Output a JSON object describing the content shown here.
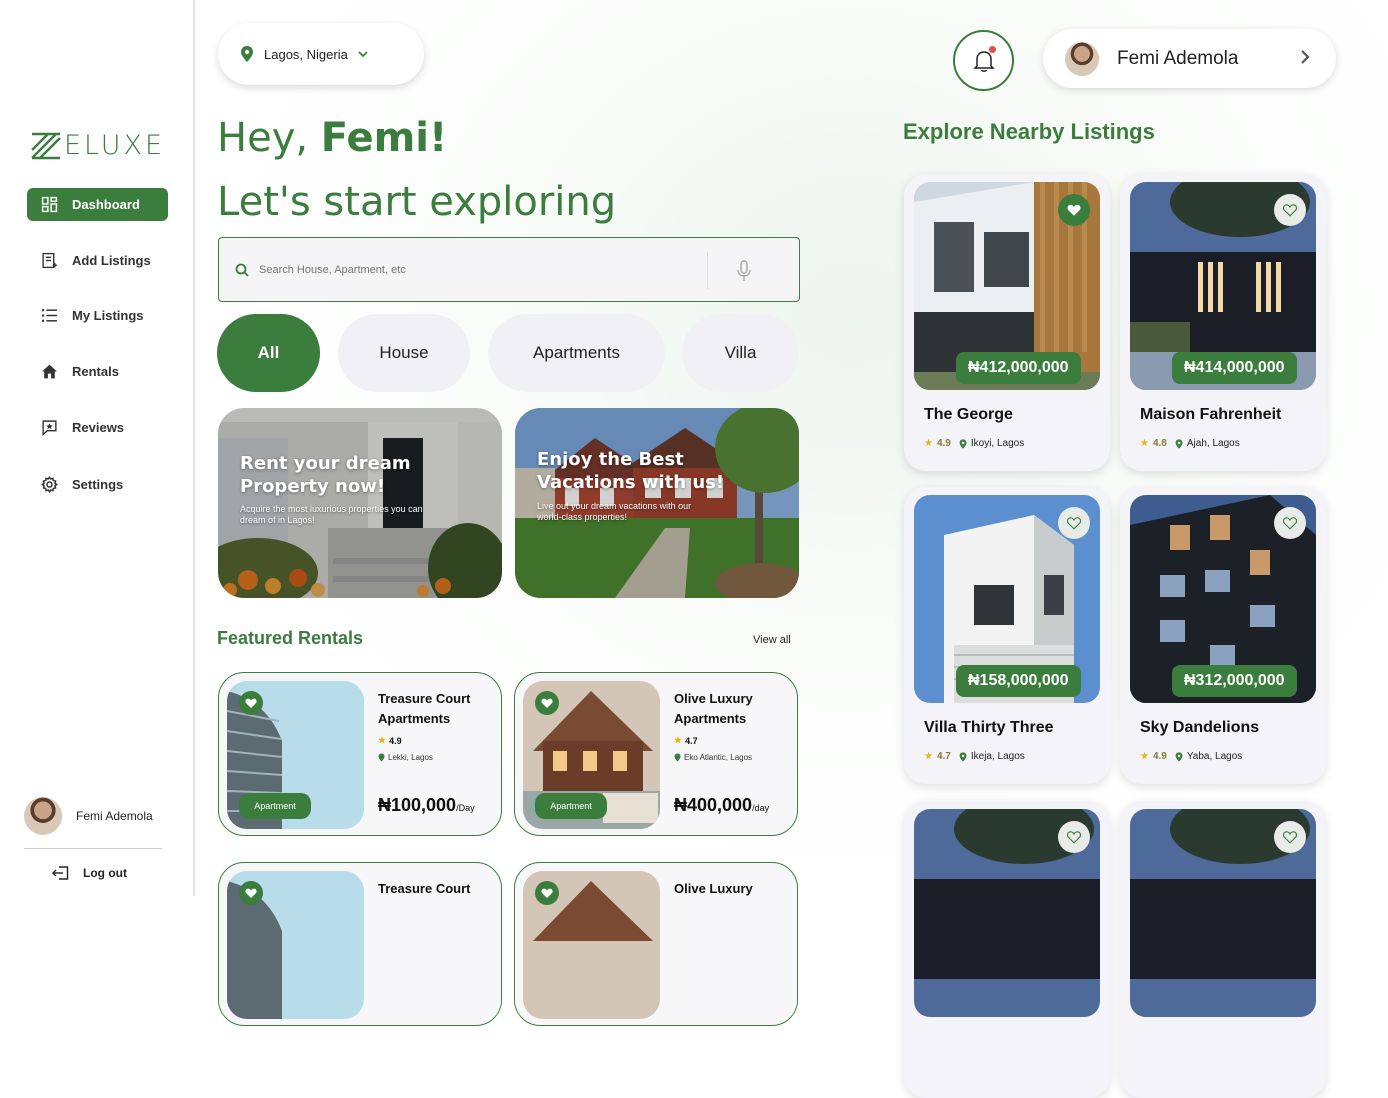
{
  "brand": {
    "name": "ELUXE",
    "accent": "#3a7d3c"
  },
  "sidebar": {
    "items": [
      {
        "label": "Dashboard",
        "icon": "dashboard-icon",
        "active": true
      },
      {
        "label": "Add Listings",
        "icon": "add-listing-icon"
      },
      {
        "label": "My Listings",
        "icon": "list-icon"
      },
      {
        "label": "Rentals",
        "icon": "home-icon"
      },
      {
        "label": "Reviews",
        "icon": "review-icon"
      },
      {
        "label": "Settings",
        "icon": "gear-icon"
      }
    ],
    "user_name": "Femi Ademola",
    "logout_label": "Log out"
  },
  "header": {
    "location": "Lagos, Nigeria",
    "user_name": "Femi Ademola"
  },
  "hero": {
    "greeting_prefix": "Hey, ",
    "greeting_name": "Femi!",
    "subtitle": "Let's start exploring"
  },
  "search": {
    "placeholder": "Search House, Apartment, etc"
  },
  "filters": [
    "All",
    "House",
    "Apartments",
    "Villa"
  ],
  "banners": [
    {
      "title": "Rent your dream Property now!",
      "text": "Acquire the most luxurious properties you can dream of in Lagos!"
    },
    {
      "title": "Enjoy the Best Vacations with us!",
      "text": "Live out your dream vacations with our world-class properties!"
    }
  ],
  "featured": {
    "title": "Featured Rentals",
    "view_all": "View all",
    "items": [
      {
        "name": "Treasure Court Apartments",
        "rating": "4.9",
        "location": "Lekki, Lagos",
        "badge": "Apartment",
        "price": "₦100,000",
        "unit": "/Day"
      },
      {
        "name": "Olive Luxury Apartments",
        "rating": "4.7",
        "location": "Eko Atlantic, Lagos",
        "badge": "Apartment",
        "price": "₦400,000",
        "unit": "/day"
      },
      {
        "name": "Treasure Court",
        "rating": "",
        "location": "",
        "badge": "",
        "price": "",
        "unit": ""
      },
      {
        "name": "Olive Luxury",
        "rating": "",
        "location": "",
        "badge": "",
        "price": "",
        "unit": ""
      }
    ]
  },
  "nearby": {
    "title": "Explore Nearby Listings",
    "items": [
      {
        "name": "The George",
        "rating": "4.9",
        "location": "Ikoyi, Lagos",
        "price": "₦412,000,000",
        "favorite": true
      },
      {
        "name": "Maison Fahrenheit",
        "rating": "4.8",
        "location": "Ajah, Lagos",
        "price": "₦414,000,000",
        "favorite": false
      },
      {
        "name": "Villa Thirty Three",
        "rating": "4.7",
        "location": "Ikeja, Lagos",
        "price": "₦158,000,000",
        "favorite": false
      },
      {
        "name": "Sky Dandelions",
        "rating": "4.9",
        "location": "Yaba, Lagos",
        "price": "₦312,000,000",
        "favorite": false
      }
    ]
  }
}
